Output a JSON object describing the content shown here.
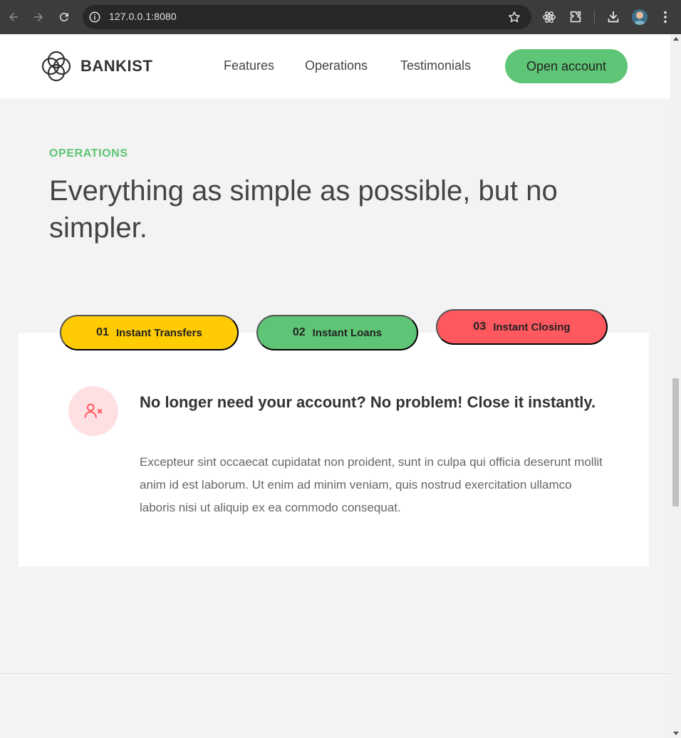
{
  "browser": {
    "url": "127.0.0.1:8080",
    "back_icon": "arrow-left-icon",
    "forward_icon": "arrow-right-icon",
    "reload_icon": "reload-icon",
    "info_icon": "info-icon",
    "bookmark_icon": "star-icon",
    "extensions": [
      "react-devtools-icon",
      "puzzle-extensions-icon"
    ],
    "download_icon": "download-icon",
    "menu_icon": "kebab-menu-icon"
  },
  "header": {
    "logo_text": "BANKIST",
    "nav": {
      "features": "Features",
      "operations": "Operations",
      "testimonials": "Testimonials"
    },
    "cta": "Open account"
  },
  "section": {
    "label": "OPERATIONS",
    "title": "Everything as simple as possible, but no simpler."
  },
  "operations": {
    "tabs": [
      {
        "num": "01",
        "label": "Instant Transfers",
        "color": "#ffcb03"
      },
      {
        "num": "02",
        "label": "Instant Loans",
        "color": "#5ec576"
      },
      {
        "num": "03",
        "label": "Instant Closing",
        "color": "#ff585f",
        "active": true
      }
    ],
    "active_content": {
      "icon": "user-x-icon",
      "heading": "No longer need your account? No problem! Close it instantly.",
      "body": "Excepteur sint occaecat cupidatat non proident, sunt in culpa qui officia deserunt mollit anim id est laborum. Ut enim ad minim veniam, quis nostrud exercitation ullamco laboris nisi ut aliquip ex ea commodo consequat."
    }
  },
  "colors": {
    "primary": "#5ec576",
    "secondary": "#ffcb03",
    "tertiary": "#ff585f",
    "page_bg": "#f3f3f3"
  }
}
